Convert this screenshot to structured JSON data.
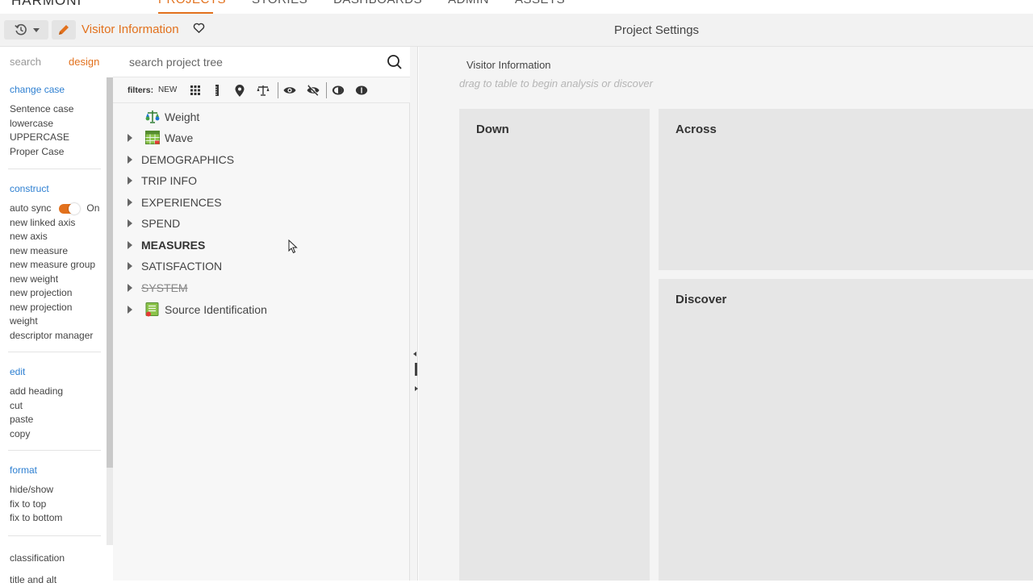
{
  "topnav": {
    "brand": "HARMONI",
    "tabs": [
      "PROJECTS",
      "STORIES",
      "DASHBOARDS",
      "ADMIN",
      "ASSETS"
    ],
    "active_tab": "PROJECTS"
  },
  "header": {
    "project_title": "Visitor Information",
    "settings_title": "Project Settings"
  },
  "sidebar": {
    "tabs": {
      "search": "search",
      "design": "design"
    },
    "groups": [
      {
        "title": "change case",
        "items": [
          "Sentence case",
          "lowercase",
          "UPPERCASE",
          "Proper Case"
        ]
      },
      {
        "title": "construct",
        "auto_sync_label": "auto sync",
        "auto_sync_state": "On",
        "items": [
          "new linked axis",
          "new axis",
          "new measure",
          "new measure group",
          "new weight",
          "new projection",
          "new projection",
          "weight",
          "descriptor manager"
        ]
      },
      {
        "title": "edit",
        "items": [
          "add heading",
          "cut",
          "paste",
          "copy"
        ]
      },
      {
        "title": "format",
        "items": [
          "hide/show",
          "fix to top",
          "fix to bottom"
        ]
      }
    ],
    "footer_items": [
      "classification",
      "title and alt"
    ]
  },
  "tree_panel": {
    "search_placeholder": "search project tree",
    "filters_label": "filters:",
    "filter_new": "NEW",
    "nodes": [
      {
        "label": "Weight",
        "icon": "weight-scale-icon",
        "expandable": false
      },
      {
        "label": "Wave",
        "icon": "table-grid-icon",
        "expandable": true
      },
      {
        "label": "DEMOGRAPHICS",
        "expandable": true
      },
      {
        "label": "TRIP INFO",
        "expandable": true
      },
      {
        "label": "EXPERIENCES",
        "expandable": true
      },
      {
        "label": "SPEND",
        "expandable": true
      },
      {
        "label": "MEASURES",
        "expandable": true,
        "bold": true
      },
      {
        "label": "SATISFACTION",
        "expandable": true
      },
      {
        "label": "SYSTEM",
        "expandable": true,
        "strikethrough": true
      },
      {
        "label": "Source Identification",
        "icon": "source-list-icon",
        "expandable": true
      }
    ]
  },
  "main": {
    "title": "Visitor Information",
    "hint": "drag to table to begin analysis or discover",
    "panels": {
      "down": "Down",
      "across": "Across",
      "discover": "Discover"
    }
  },
  "colors": {
    "accent": "#e2711d",
    "link": "#2d7fd1",
    "panel": "#e6e6e6"
  }
}
